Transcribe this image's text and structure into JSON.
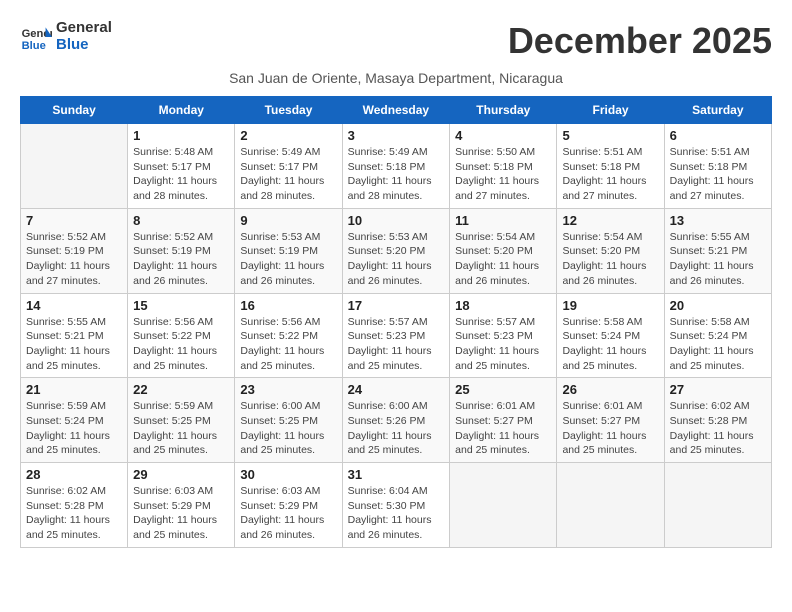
{
  "header": {
    "logo_line1": "General",
    "logo_line2": "Blue",
    "month_title": "December 2025",
    "subtitle": "San Juan de Oriente, Masaya Department, Nicaragua"
  },
  "weekdays": [
    "Sunday",
    "Monday",
    "Tuesday",
    "Wednesday",
    "Thursday",
    "Friday",
    "Saturday"
  ],
  "weeks": [
    [
      {
        "day": "",
        "info": ""
      },
      {
        "day": "1",
        "info": "Sunrise: 5:48 AM\nSunset: 5:17 PM\nDaylight: 11 hours and 28 minutes."
      },
      {
        "day": "2",
        "info": "Sunrise: 5:49 AM\nSunset: 5:17 PM\nDaylight: 11 hours and 28 minutes."
      },
      {
        "day": "3",
        "info": "Sunrise: 5:49 AM\nSunset: 5:18 PM\nDaylight: 11 hours and 28 minutes."
      },
      {
        "day": "4",
        "info": "Sunrise: 5:50 AM\nSunset: 5:18 PM\nDaylight: 11 hours and 27 minutes."
      },
      {
        "day": "5",
        "info": "Sunrise: 5:51 AM\nSunset: 5:18 PM\nDaylight: 11 hours and 27 minutes."
      },
      {
        "day": "6",
        "info": "Sunrise: 5:51 AM\nSunset: 5:18 PM\nDaylight: 11 hours and 27 minutes."
      }
    ],
    [
      {
        "day": "7",
        "info": "Sunrise: 5:52 AM\nSunset: 5:19 PM\nDaylight: 11 hours and 27 minutes."
      },
      {
        "day": "8",
        "info": "Sunrise: 5:52 AM\nSunset: 5:19 PM\nDaylight: 11 hours and 26 minutes."
      },
      {
        "day": "9",
        "info": "Sunrise: 5:53 AM\nSunset: 5:19 PM\nDaylight: 11 hours and 26 minutes."
      },
      {
        "day": "10",
        "info": "Sunrise: 5:53 AM\nSunset: 5:20 PM\nDaylight: 11 hours and 26 minutes."
      },
      {
        "day": "11",
        "info": "Sunrise: 5:54 AM\nSunset: 5:20 PM\nDaylight: 11 hours and 26 minutes."
      },
      {
        "day": "12",
        "info": "Sunrise: 5:54 AM\nSunset: 5:20 PM\nDaylight: 11 hours and 26 minutes."
      },
      {
        "day": "13",
        "info": "Sunrise: 5:55 AM\nSunset: 5:21 PM\nDaylight: 11 hours and 26 minutes."
      }
    ],
    [
      {
        "day": "14",
        "info": "Sunrise: 5:55 AM\nSunset: 5:21 PM\nDaylight: 11 hours and 25 minutes."
      },
      {
        "day": "15",
        "info": "Sunrise: 5:56 AM\nSunset: 5:22 PM\nDaylight: 11 hours and 25 minutes."
      },
      {
        "day": "16",
        "info": "Sunrise: 5:56 AM\nSunset: 5:22 PM\nDaylight: 11 hours and 25 minutes."
      },
      {
        "day": "17",
        "info": "Sunrise: 5:57 AM\nSunset: 5:23 PM\nDaylight: 11 hours and 25 minutes."
      },
      {
        "day": "18",
        "info": "Sunrise: 5:57 AM\nSunset: 5:23 PM\nDaylight: 11 hours and 25 minutes."
      },
      {
        "day": "19",
        "info": "Sunrise: 5:58 AM\nSunset: 5:24 PM\nDaylight: 11 hours and 25 minutes."
      },
      {
        "day": "20",
        "info": "Sunrise: 5:58 AM\nSunset: 5:24 PM\nDaylight: 11 hours and 25 minutes."
      }
    ],
    [
      {
        "day": "21",
        "info": "Sunrise: 5:59 AM\nSunset: 5:24 PM\nDaylight: 11 hours and 25 minutes."
      },
      {
        "day": "22",
        "info": "Sunrise: 5:59 AM\nSunset: 5:25 PM\nDaylight: 11 hours and 25 minutes."
      },
      {
        "day": "23",
        "info": "Sunrise: 6:00 AM\nSunset: 5:25 PM\nDaylight: 11 hours and 25 minutes."
      },
      {
        "day": "24",
        "info": "Sunrise: 6:00 AM\nSunset: 5:26 PM\nDaylight: 11 hours and 25 minutes."
      },
      {
        "day": "25",
        "info": "Sunrise: 6:01 AM\nSunset: 5:27 PM\nDaylight: 11 hours and 25 minutes."
      },
      {
        "day": "26",
        "info": "Sunrise: 6:01 AM\nSunset: 5:27 PM\nDaylight: 11 hours and 25 minutes."
      },
      {
        "day": "27",
        "info": "Sunrise: 6:02 AM\nSunset: 5:28 PM\nDaylight: 11 hours and 25 minutes."
      }
    ],
    [
      {
        "day": "28",
        "info": "Sunrise: 6:02 AM\nSunset: 5:28 PM\nDaylight: 11 hours and 25 minutes."
      },
      {
        "day": "29",
        "info": "Sunrise: 6:03 AM\nSunset: 5:29 PM\nDaylight: 11 hours and 25 minutes."
      },
      {
        "day": "30",
        "info": "Sunrise: 6:03 AM\nSunset: 5:29 PM\nDaylight: 11 hours and 26 minutes."
      },
      {
        "day": "31",
        "info": "Sunrise: 6:04 AM\nSunset: 5:30 PM\nDaylight: 11 hours and 26 minutes."
      },
      {
        "day": "",
        "info": ""
      },
      {
        "day": "",
        "info": ""
      },
      {
        "day": "",
        "info": ""
      }
    ]
  ]
}
